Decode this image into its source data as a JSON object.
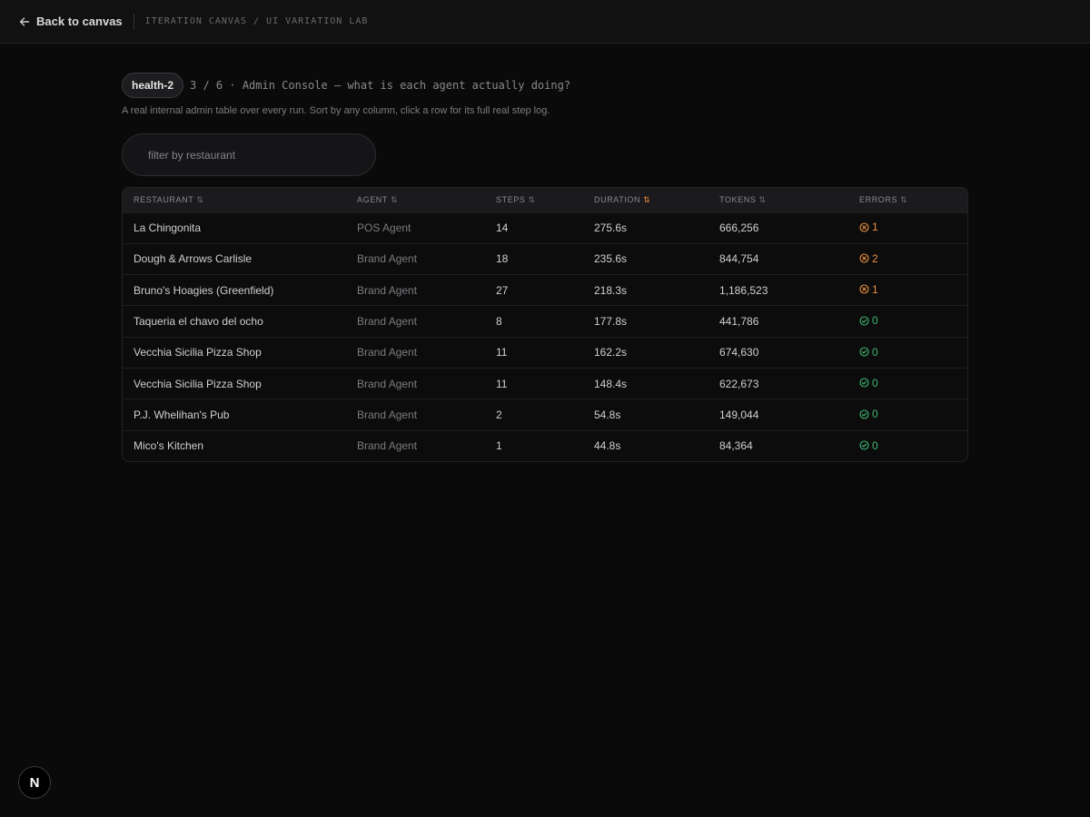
{
  "topbar": {
    "back_label": "Back to canvas",
    "breadcrumb": "ITERATION CANVAS / UI VARIATION LAB"
  },
  "header": {
    "pill": "health-2",
    "title": "3 / 6 · Admin Console — what is each agent actually doing?",
    "subtitle": "A real internal admin table over every run. Sort by any column, click a row for its full real step log."
  },
  "filter": {
    "placeholder": "filter by restaurant",
    "value": ""
  },
  "table": {
    "columns": [
      "RESTAURANT",
      "AGENT",
      "STEPS",
      "DURATION",
      "TOKENS",
      "ERRORS"
    ],
    "sort_glyph": "⇅",
    "active_sort": "DURATION",
    "rows": [
      {
        "restaurant": "La Chingonita",
        "agent": "POS Agent",
        "steps": "14",
        "duration": "275.6s",
        "tokens": "666,256",
        "errors": "1"
      },
      {
        "restaurant": "Dough & Arrows Carlisle",
        "agent": "Brand Agent",
        "steps": "18",
        "duration": "235.6s",
        "tokens": "844,754",
        "errors": "2"
      },
      {
        "restaurant": "Bruno's Hoagies (Greenfield)",
        "agent": "Brand Agent",
        "steps": "27",
        "duration": "218.3s",
        "tokens": "1,186,523",
        "errors": "1"
      },
      {
        "restaurant": "Taqueria el chavo del ocho",
        "agent": "Brand Agent",
        "steps": "8",
        "duration": "177.8s",
        "tokens": "441,786",
        "errors": "0"
      },
      {
        "restaurant": "Vecchia Sicilia Pizza Shop",
        "agent": "Brand Agent",
        "steps": "11",
        "duration": "162.2s",
        "tokens": "674,630",
        "errors": "0"
      },
      {
        "restaurant": "Vecchia Sicilia Pizza Shop",
        "agent": "Brand Agent",
        "steps": "11",
        "duration": "148.4s",
        "tokens": "622,673",
        "errors": "0"
      },
      {
        "restaurant": "P.J. Whelihan's Pub",
        "agent": "Brand Agent",
        "steps": "2",
        "duration": "54.8s",
        "tokens": "149,044",
        "errors": "0"
      },
      {
        "restaurant": "Mico's Kitchen",
        "agent": "Brand Agent",
        "steps": "1",
        "duration": "44.8s",
        "tokens": "84,364",
        "errors": "0"
      }
    ]
  },
  "badge": {
    "letter": "N"
  },
  "colors": {
    "accent": "#e38b3a",
    "error": "#e8913f",
    "ok": "#3fb871",
    "background": "#0a0a0a"
  },
  "icons": {
    "back": "arrow-left-icon",
    "sort": "sort-arrows-icon",
    "error": "x-circle-icon",
    "ok": "check-circle-icon"
  }
}
